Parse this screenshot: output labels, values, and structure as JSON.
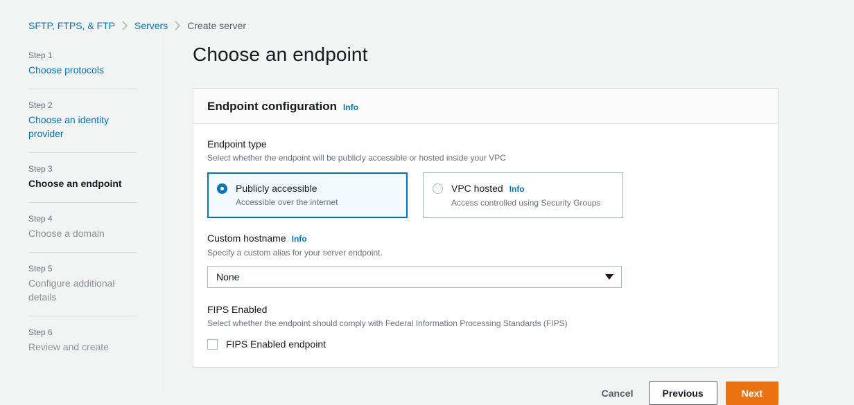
{
  "breadcrumb": {
    "items": [
      {
        "label": "SFTP, FTPS, & FTP",
        "current": false
      },
      {
        "label": "Servers",
        "current": false
      },
      {
        "label": "Create server",
        "current": true
      }
    ]
  },
  "sidebar": {
    "steps": [
      {
        "number": "Step 1",
        "title": "Choose protocols",
        "state": "link"
      },
      {
        "number": "Step 2",
        "title": "Choose an identity provider",
        "state": "link"
      },
      {
        "number": "Step 3",
        "title": "Choose an endpoint",
        "state": "active"
      },
      {
        "number": "Step 4",
        "title": "Choose a domain",
        "state": "muted"
      },
      {
        "number": "Step 5",
        "title": "Configure additional details",
        "state": "muted"
      },
      {
        "number": "Step 6",
        "title": "Review and create",
        "state": "muted"
      }
    ]
  },
  "main": {
    "page_title": "Choose an endpoint",
    "panel": {
      "title": "Endpoint configuration",
      "info_label": "Info"
    },
    "endpoint_type": {
      "label": "Endpoint type",
      "description": "Select whether the endpoint will be publicly accessible or hosted inside your VPC",
      "options": [
        {
          "title": "Publicly accessible",
          "description": "Accessible over the internet",
          "info_label": "",
          "selected": true
        },
        {
          "title": "VPC hosted",
          "description": "Access controlled using Security Groups",
          "info_label": "Info",
          "selected": false
        }
      ]
    },
    "custom_hostname": {
      "label": "Custom hostname",
      "info_label": "Info",
      "description": "Specify a custom alias for your server endpoint.",
      "value": "None",
      "options": [
        "None"
      ]
    },
    "fips": {
      "label": "FIPS Enabled",
      "description": "Select whether the endpoint should comply with Federal Information Processing Standards (FIPS)",
      "checkbox_label": "FIPS Enabled endpoint",
      "checked": false
    }
  },
  "footer": {
    "cancel_label": "Cancel",
    "previous_label": "Previous",
    "next_label": "Next"
  },
  "colors": {
    "link": "#0073bb",
    "primary": "#ec7211",
    "page_background": "#f2f3f3",
    "selected_tile_background": "#f1faff"
  }
}
